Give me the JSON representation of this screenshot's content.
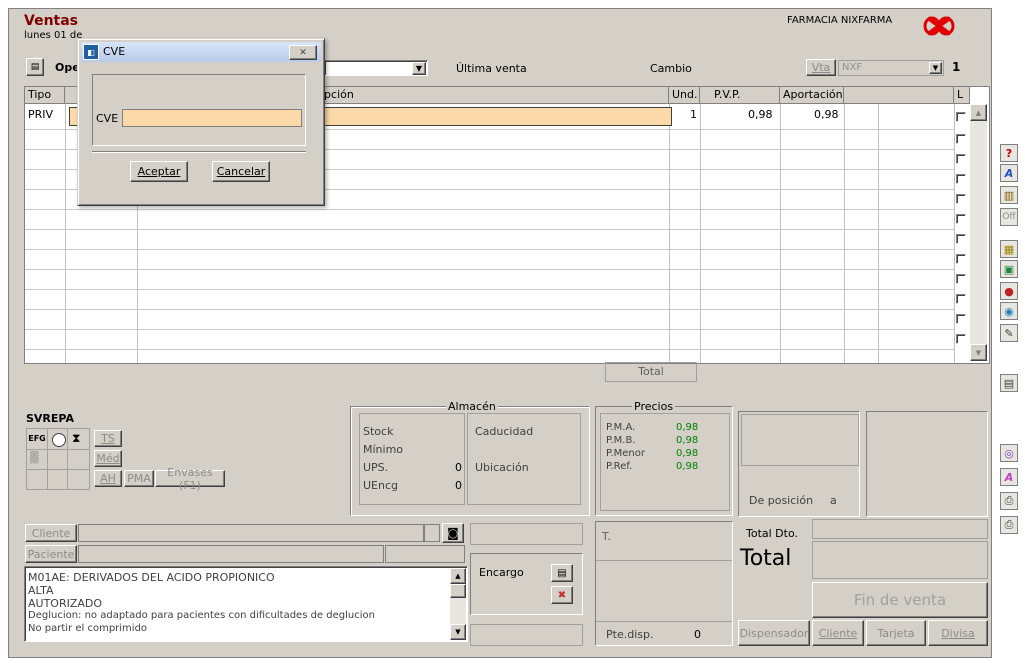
{
  "header": {
    "title": "Ventas",
    "date_prefix": "lunes 01 de",
    "pharmacy": "FARMACIA NIXFARMA"
  },
  "toolbar": {
    "op_label": "Ope",
    "ultima_venta": "Última venta",
    "cambio": "Cambio",
    "vta_label": "Vta",
    "vta_value": "NXF",
    "counter": "1"
  },
  "grid": {
    "headers": [
      "Tipo",
      "ipción",
      "Und.",
      "P.V.P.",
      "Aportación",
      "L"
    ],
    "row1": {
      "tipo": "PRIV",
      "und": "1",
      "pvp": "0,98",
      "aportacion": "0,98"
    },
    "total_label": "Total"
  },
  "svrepa": {
    "title": "SVREPA",
    "efg": "EFG",
    "ts": "TS",
    "med": "Méd",
    "ah": "AH",
    "pma": "PMA",
    "envases": "Envases (F1)"
  },
  "almacen": {
    "title": "Almacén",
    "stock": "Stock",
    "minimo": "Mínimo",
    "ups": "UPS.",
    "ups_val": "0",
    "uencg": "UEncg",
    "uencg_val": "0",
    "caducidad": "Caducidad",
    "ubicacion": "Ubicación"
  },
  "precios": {
    "title": "Precios",
    "pma": "P.M.A.",
    "pma_val": "0,98",
    "pmb": "P.M.B.",
    "pmb_val": "0,98",
    "pmenor": "P.Menor",
    "pmenor_val": "0,98",
    "pref": "P.Ref.",
    "pref_val": "0,98"
  },
  "posicion": {
    "de": "De posición",
    "a": "a"
  },
  "cliente": {
    "cliente_btn": "Cliente",
    "paciente_btn": "Paciente",
    "notes": [
      "M01AE: DERIVADOS DEL ACIDO PROPIONICO",
      "ALTA",
      "AUTORIZADO",
      "Deglucion: no adaptado para pacientes con dificultades de deglucion",
      "No partir el comprimido"
    ]
  },
  "encargo": {
    "label": "Encargo"
  },
  "totals": {
    "t_label": "T.",
    "pte_disp": "Pte.disp.",
    "pte_val": "0",
    "total_dto": "Total Dto.",
    "total": "Total"
  },
  "buttons": {
    "fin_venta": "Fin de venta",
    "dispensador": "Dispensador",
    "cliente": "Cliente",
    "tarjeta": "Tarjeta",
    "divisa": "Divisa"
  },
  "dialog": {
    "title": "CVE",
    "field_label": "CVE",
    "field_value": "",
    "aceptar": "Aceptar",
    "cancelar": "Cancelar"
  },
  "colors": {
    "title": "#800000",
    "field_highlight": "#fcd9a8",
    "green": "#008000"
  }
}
